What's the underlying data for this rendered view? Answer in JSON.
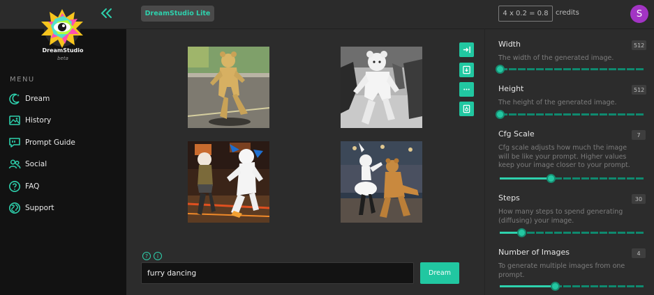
{
  "brand": {
    "name": "DreamStudio",
    "subtitle": "beta"
  },
  "header": {
    "app_label": "DreamStudio Lite",
    "credits_formula": "4 x 0.2 = 0.8",
    "credits_label": "credits",
    "avatar_initial": "S"
  },
  "menu": {
    "title": "MENU",
    "items": [
      {
        "label": "Dream",
        "icon": "dream-icon"
      },
      {
        "label": "History",
        "icon": "history-icon"
      },
      {
        "label": "Prompt Guide",
        "icon": "prompt-guide-icon"
      },
      {
        "label": "Social",
        "icon": "social-icon"
      },
      {
        "label": "FAQ",
        "icon": "faq-icon"
      },
      {
        "label": "Support",
        "icon": "support-icon"
      }
    ]
  },
  "results": {
    "images": [
      "yellow furry bear costume dancing on a street",
      "white furry bear costume dancing at a party",
      "two furry costumes dancing in a club",
      "white and tan furry costumes dancing in a hall"
    ],
    "tools": [
      "export-icon",
      "download-icon",
      "more-icon",
      "copy-icon"
    ]
  },
  "prompt": {
    "value": "furry dancing",
    "button_label": "Dream"
  },
  "settings": [
    {
      "title": "Width",
      "value": "512",
      "description": "The width of the generated image.",
      "level": 0.0
    },
    {
      "title": "Height",
      "value": "512",
      "description": "The height of the generated image.",
      "level": 0.0
    },
    {
      "title": "Cfg Scale",
      "value": "7",
      "description": "Cfg scale adjusts how much the image will be like your prompt. Higher values keep your image closer to your prompt.",
      "level": 0.35
    },
    {
      "title": "Steps",
      "value": "30",
      "description": "How many steps to spend generating (diffusing) your image.",
      "level": 0.15
    },
    {
      "title": "Number of Images",
      "value": "4",
      "description": "To generate multiple images from one prompt.",
      "level": 0.38
    }
  ],
  "colors": {
    "accent": "#2ed1ad",
    "avatar": "#a234c4",
    "sidebar": "#121212",
    "panel": "#2c2c2c"
  }
}
